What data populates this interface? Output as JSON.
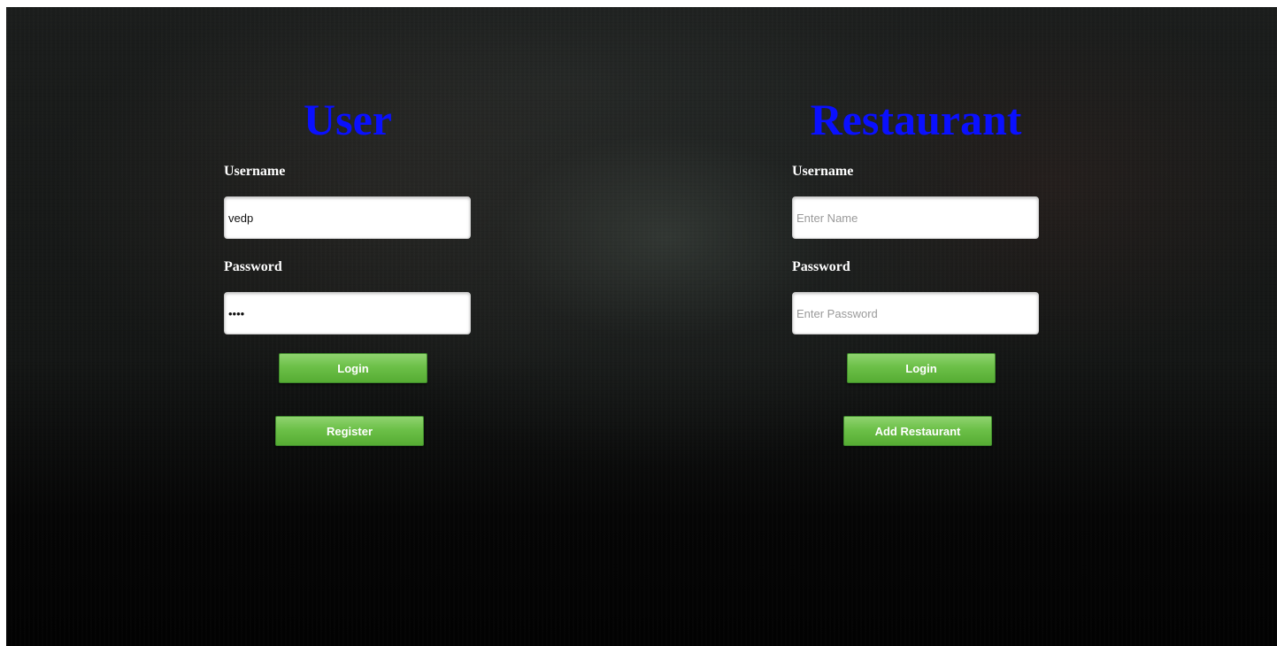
{
  "user_panel": {
    "title": "User",
    "username_label": "Username",
    "username_value": "vedp",
    "password_label": "Password",
    "password_value": "abcd",
    "login_label": "Login",
    "register_label": "Register"
  },
  "restaurant_panel": {
    "title": "Restaurant",
    "username_label": "Username",
    "username_placeholder": "Enter Name",
    "password_label": "Password",
    "password_placeholder": "Enter Password",
    "login_label": "Login",
    "add_restaurant_label": "Add Restaurant"
  },
  "colors": {
    "title": "#0a10ff",
    "button": "#6cc048",
    "label": "#ffffff"
  }
}
